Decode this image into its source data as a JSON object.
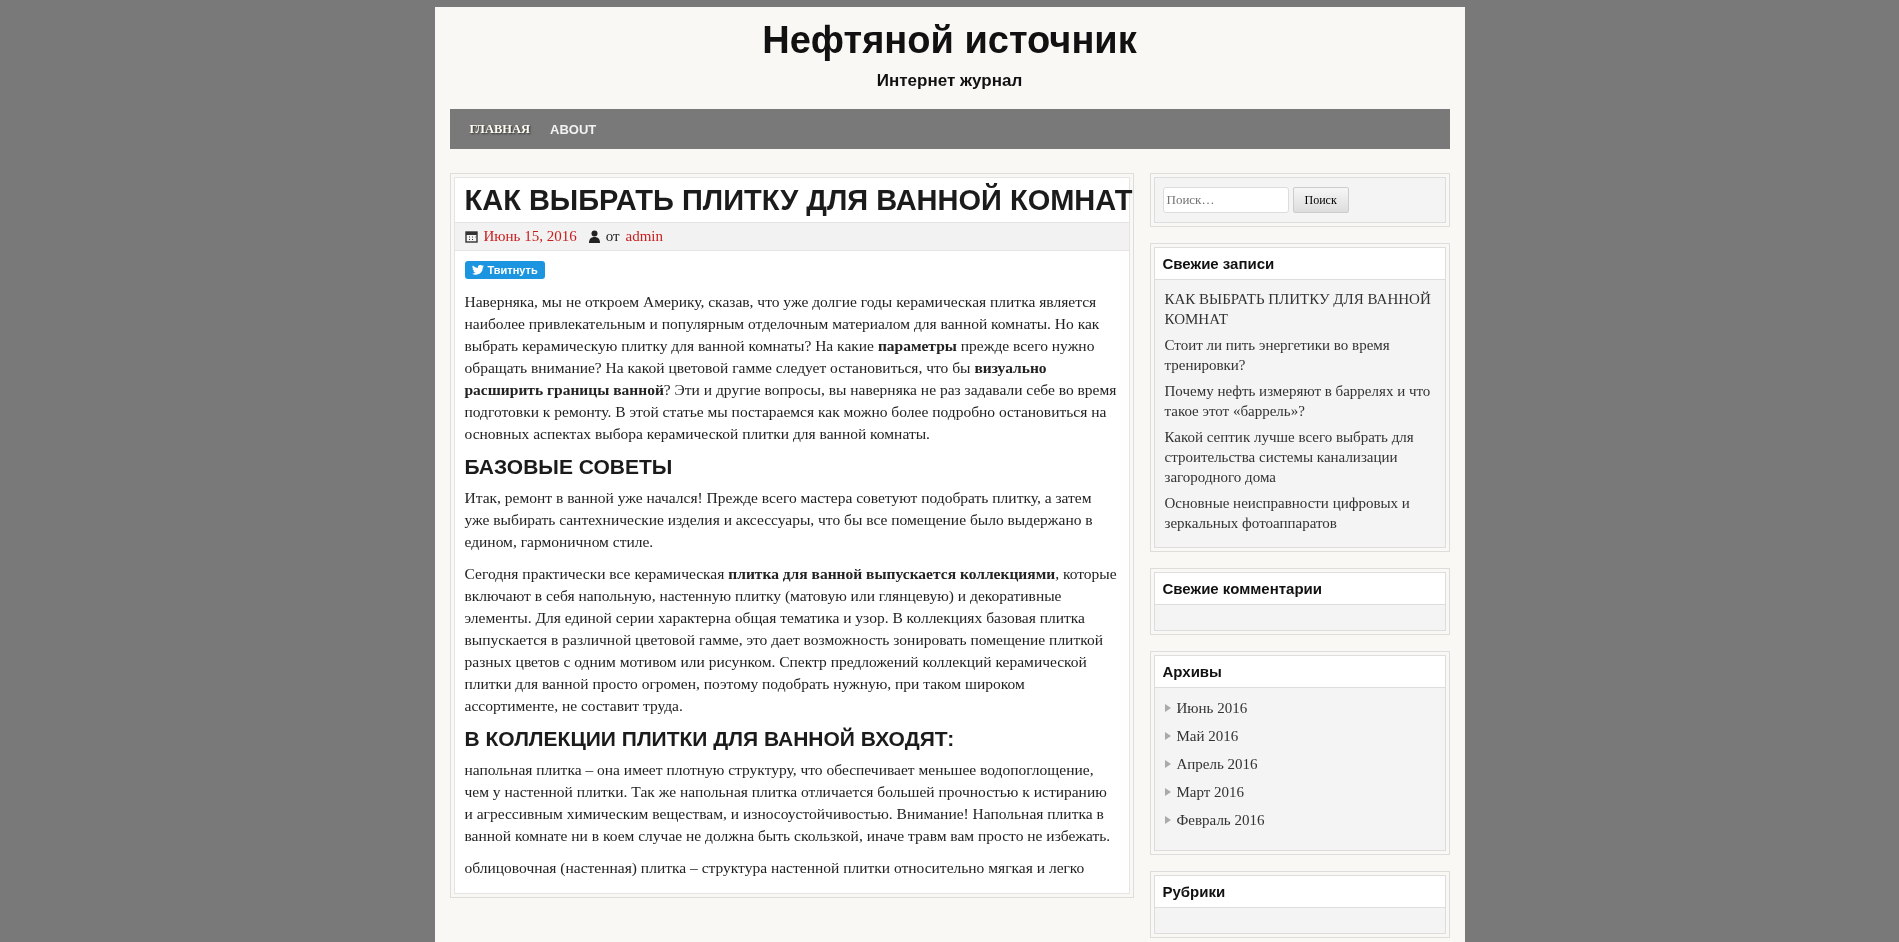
{
  "header": {
    "site_title": "Нефтяной источник",
    "tagline": "Интернет журнал"
  },
  "nav": [
    {
      "label": "ГЛАВНАЯ",
      "selected": true
    },
    {
      "label": "ABOUT",
      "selected": false
    }
  ],
  "article": {
    "title": "КАК ВЫБРАТЬ ПЛИТКУ ДЛЯ ВАННОЙ КОМНАТ",
    "date": "Июнь 15, 2016",
    "author_prefix": "от",
    "author": "admin",
    "tweet_button": "Твитнуть",
    "blocks": [
      {
        "kind": "paragraph",
        "text": "Наверняка, мы не откроем Америку, сказав, что уже долгие годы керамическая плитка является наиболее привлекательным и популярным отделочным материалом для ванной комнаты. Но как выбрать керамическую плитку для ванной комнаты? На какие **параметры** прежде всего нужно обращать внимание? На какой цветовой гамме следует остановиться, что бы **визуально расширить границы ванной**? Эти и другие вопросы, вы наверняка не раз задавали себе во время подготовки к ремонту. В этой статье мы постараемся как можно более подробно остановиться на основных аспектах выбора керамической плитки для ванной комнаты."
      },
      {
        "kind": "heading",
        "text": "БАЗОВЫЕ СОВЕТЫ"
      },
      {
        "kind": "paragraph",
        "text": "Итак, ремонт в ванной уже начался! Прежде всего мастера советуют подобрать плитку, а затем уже выбирать сантехнические изделия и аксессуары, что бы все помещение было выдержано в едином, гармоничном стиле."
      },
      {
        "kind": "paragraph",
        "text": "Сегодня практически все керамическая **плитка для ванной выпускается коллекциями**, которые включают в себя напольную, настенную плитку (матовую или глянцевую) и декоративные элементы. Для единой серии характерна общая тематика и узор. В коллекциях базовая плитка выпускается в различной цветовой гамме, это дает возможность зонировать помещение плиткой разных цветов с одним мотивом или рисунком. Спектр предложений коллекций керамической плитки для ванной просто огромен, поэтому подобрать нужную, при таком широком ассортименте, не составит труда."
      },
      {
        "kind": "heading",
        "text": "В КОЛЛЕКЦИИ ПЛИТКИ ДЛЯ ВАННОЙ ВХОДЯТ:"
      },
      {
        "kind": "paragraph",
        "text": "напольная плитка – она имеет плотную структуру, что обеспечивает меньшее водопоглощение, чем у настенной плитки. Так же напольная плитка отличается большей прочностью к истиранию и агрессивным химическим веществам, и износоустойчивостью. Внимание! Напольная плитка в ванной комнате ни в коем случае не должна быть скользкой, иначе травм вам просто не избежать."
      },
      {
        "kind": "paragraph",
        "text": "облицовочная (настенная) плитка – структура настенной плитки относительно мягкая и легко"
      }
    ]
  },
  "sidebar": {
    "search": {
      "placeholder": "Поиск…",
      "button": "Поиск"
    },
    "widgets": [
      {
        "title": "Свежие записи",
        "kind": "links",
        "items": [
          "КАК ВЫБРАТЬ ПЛИТКУ ДЛЯ ВАННОЙ КОМНАТ",
          "Стоит ли пить энергетики во время тренировки?",
          "Почему нефть измеряют в баррелях и что такое этот «баррель»?",
          "Какой септик лучше всего выбрать для строительства системы канализации загородного дома",
          "Основные неисправности цифровых и зеркальных фотоаппаратов"
        ]
      },
      {
        "title": "Свежие комментарии",
        "kind": "links"
      },
      {
        "title": "Архивы",
        "kind": "bullets",
        "items": [
          "Июнь 2016",
          "Май 2016",
          "Апрель 2016",
          "Март 2016",
          "Февраль 2016"
        ]
      },
      {
        "title": "Рубрики",
        "kind": "links"
      }
    ]
  }
}
